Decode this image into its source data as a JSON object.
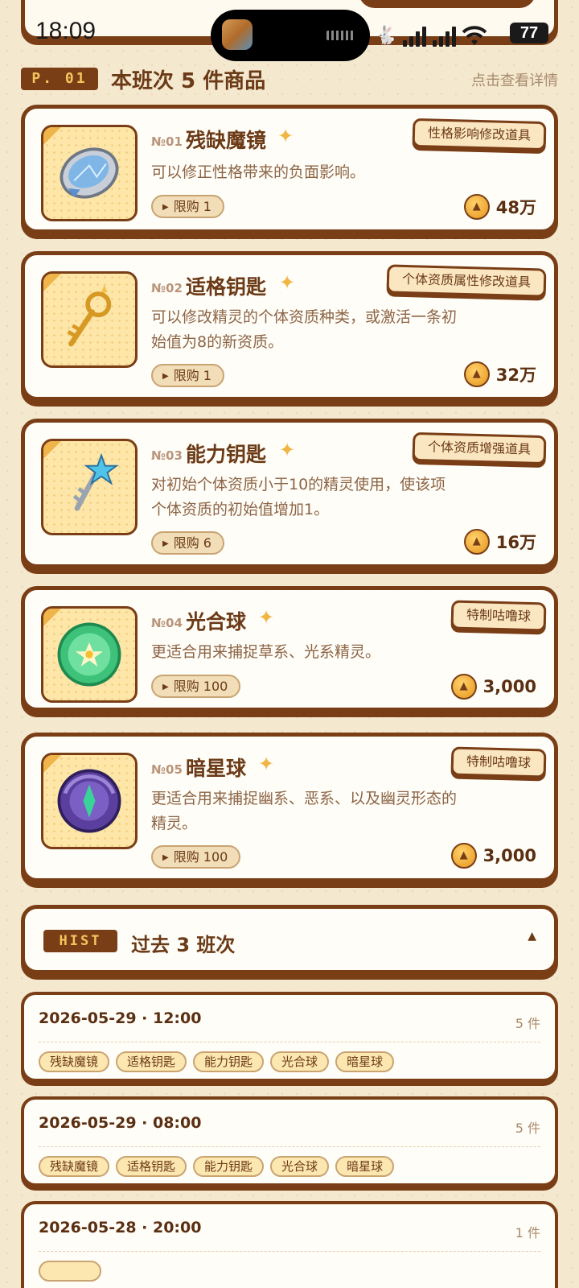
{
  "status_bar": {
    "time": "18:09",
    "battery": "77"
  },
  "section": {
    "tag": "P. 01",
    "title": "本班次 5 件商品",
    "link": "点击查看详情"
  },
  "items": [
    {
      "no": "№01",
      "name": "残缺魔镜",
      "desc": "可以修正性格带来的负面影响。",
      "limit": "限购 1",
      "badge": "性格影响修改道具",
      "price": "48万",
      "icon": "broken-mirror-icon"
    },
    {
      "no": "№02",
      "name": "适格钥匙",
      "desc": "可以修改精灵的个体资质种类，或激活一条初始值为8的新资质。",
      "limit": "限购 1",
      "badge": "个体资质属性修改道具",
      "price": "32万",
      "icon": "golden-key-icon"
    },
    {
      "no": "№03",
      "name": "能力钥匙",
      "desc": "对初始个体资质小于10的精灵使用，使该项个体资质的初始值增加1。",
      "limit": "限购 6",
      "badge": "个体资质增强道具",
      "price": "16万",
      "icon": "star-key-icon"
    },
    {
      "no": "№04",
      "name": "光合球",
      "desc": "更适合用来捕捉草系、光系精灵。",
      "limit": "限购 100",
      "badge": "特制咕噜球",
      "price": "3,000",
      "icon": "green-ball-icon"
    },
    {
      "no": "№05",
      "name": "暗星球",
      "desc": "更适合用来捕捉幽系、恶系、以及幽灵形态的精灵。",
      "limit": "限购 100",
      "badge": "特制咕噜球",
      "price": "3,000",
      "icon": "dark-ball-icon"
    }
  ],
  "history": {
    "tag": "HIST",
    "title": "过去 3 班次",
    "toggle": "▲",
    "rows": [
      {
        "date": "2026-05-29 · 12:00",
        "count": "5 件",
        "tags": [
          "残缺魔镜",
          "适格钥匙",
          "能力钥匙",
          "光合球",
          "暗星球"
        ]
      },
      {
        "date": "2026-05-29 · 08:00",
        "count": "5 件",
        "tags": [
          "残缺魔镜",
          "适格钥匙",
          "能力钥匙",
          "光合球",
          "暗星球"
        ]
      },
      {
        "date": "2026-05-28 · 20:00",
        "count": "1 件",
        "tags": []
      }
    ]
  },
  "colors": {
    "accent_brown": "#7a3e17",
    "background": "#f4e8cf",
    "gold": "#f0b542"
  }
}
